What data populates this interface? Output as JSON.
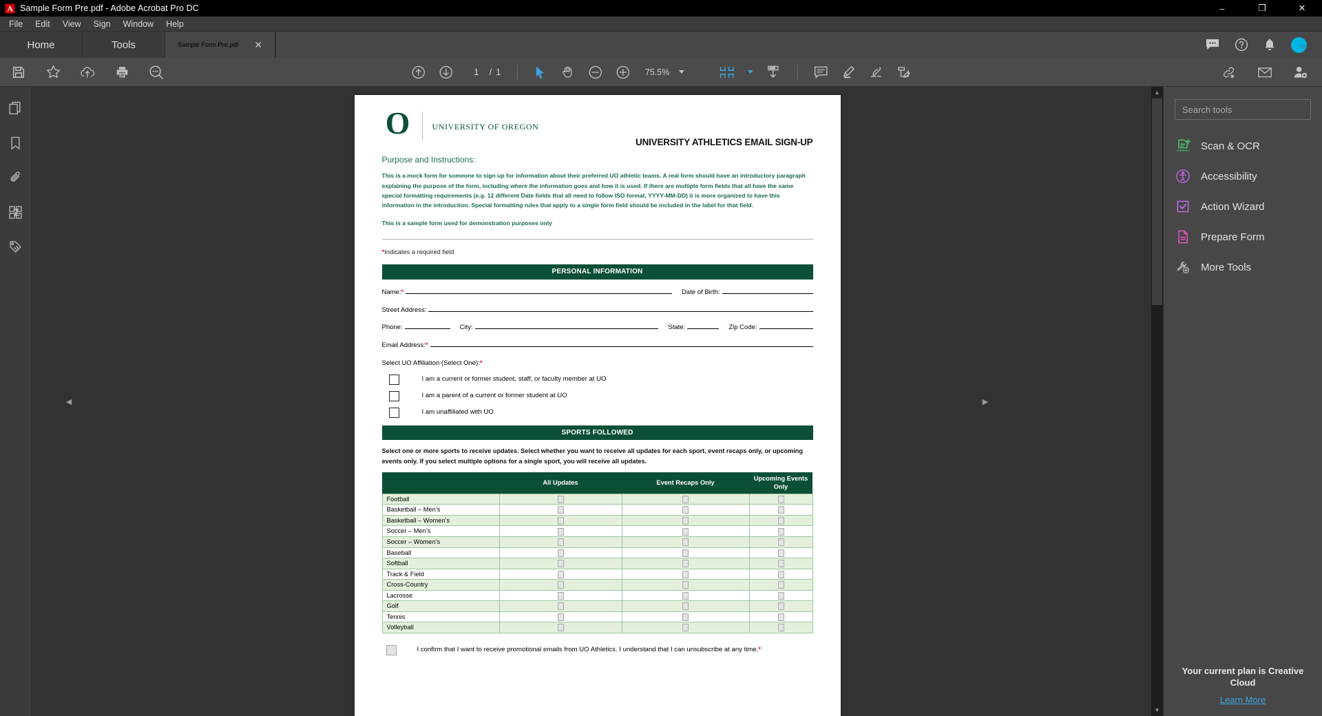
{
  "window": {
    "title": "Sample Form Pre.pdf - Adobe Acrobat Pro DC",
    "minimize": "–",
    "maximize": "❐",
    "close": "✕"
  },
  "menubar": [
    "File",
    "Edit",
    "View",
    "Sign",
    "Window",
    "Help"
  ],
  "tabs": [
    {
      "label": "Home",
      "active": false
    },
    {
      "label": "Tools",
      "active": false
    },
    {
      "label": "Sample Form Pre.pdf",
      "active": true,
      "close": "✕"
    }
  ],
  "toolbar": {
    "page_current": "1",
    "page_sep": "/",
    "page_total": "1",
    "zoom": "75.5%"
  },
  "right_panel": {
    "search_placeholder": "Search tools",
    "tools": [
      {
        "label": "Scan & OCR",
        "icon": "scan-ocr-icon",
        "color": "#4cc167"
      },
      {
        "label": "Accessibility",
        "icon": "accessibility-icon",
        "color": "#b862d6"
      },
      {
        "label": "Action Wizard",
        "icon": "action-wizard-icon",
        "color": "#c465e8"
      },
      {
        "label": "Prepare Form",
        "icon": "prepare-form-icon",
        "color": "#e854c8"
      },
      {
        "label": "More Tools",
        "icon": "more-tools-icon",
        "color": "#a7a7a7"
      }
    ],
    "plan_text": "Your current plan is Creative Cloud",
    "plan_link": "Learn More"
  },
  "document": {
    "university": "UNIVERSITY OF OREGON",
    "logo_letter": "O",
    "form_title": "UNIVERSITY ATHLETICS EMAIL SIGN-UP",
    "purpose_heading": "Purpose and Instructions:",
    "intro_paragraph": "This is a mock form for someone to sign up for information about their preferred UO athletic teams. A real form should have an introductory paragraph explaining the purpose of the form, including where the information goes and how it is used. If there are multiple form fields that all have the same special formatting requirements (e.g. 12 different Date fields that all need to follow ISO format, YYYY-MM-DD) it is more organized to have this information in the introduction. Special formatting rules that apply to a single form field should be included in the label for that field.",
    "sample_note": "This is a sample form used for demonstration purposes only",
    "required_note": "Indicates a required field",
    "section_personal": "PERSONAL INFORMATION",
    "fields": {
      "name": "Name:",
      "dob": "Date of Birth:",
      "street": "Street Address:",
      "phone": "Phone:",
      "city": "City:",
      "state": "State:",
      "zip": "Zip Code:",
      "email": "Email Address:"
    },
    "affiliation_label": "Select UO Affiliation (Select One):",
    "affiliation_options": [
      "I am a current or former student, staff, or faculty member at UO",
      "I am a parent of a current or former student at UO",
      "I am unaffiliated with UO"
    ],
    "section_sports": "SPORTS FOLLOWED",
    "sports_note": "Select one or more sports to receive updates. Select whether you want to receive all updates for each sport, event recaps only, or upcoming events only. If you select multiple options for a single sport, you will receive all updates.",
    "sports_table": {
      "headers": [
        "",
        "All Updates",
        "Event Recaps Only",
        "Upcoming Events Only"
      ],
      "rows": [
        "Football",
        "Basketball – Men’s",
        "Basketball – Women’s",
        "Soccer – Men’s",
        "Soccer – Women’s",
        "Baseball",
        "Softball",
        "Track & Field",
        "Cross-Country",
        "Lacrosse",
        "Golf",
        "Tennis",
        "Volleyball"
      ]
    },
    "confirm_text": "I confirm that I want to receive promotional emails from UO Athletics. I understand that I can unsubscribe at any time.",
    "colors": {
      "brand_green": "#0b5036",
      "table_alt": "#e4f0dc",
      "required_red": "#d81f35"
    }
  }
}
